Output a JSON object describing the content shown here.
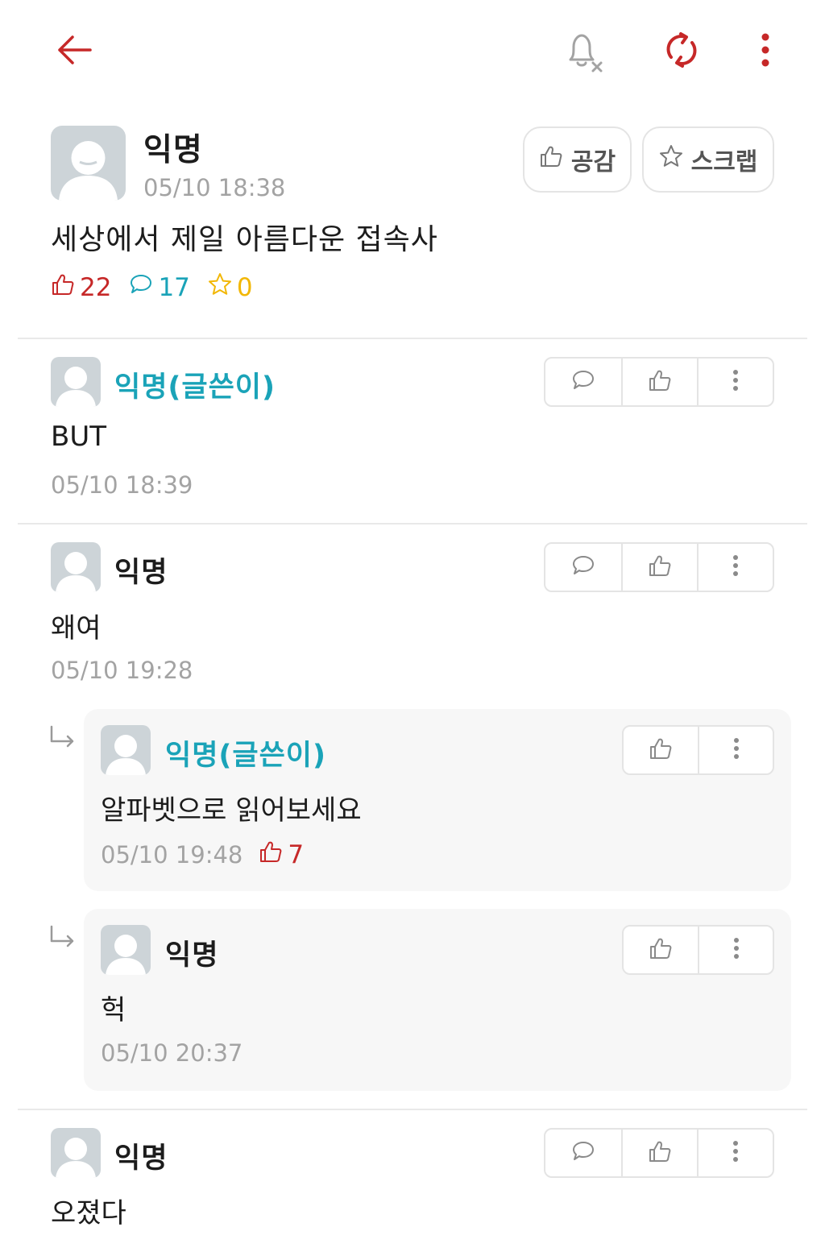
{
  "colors": {
    "accent": "#c62828",
    "op_teal": "#1aa3b8",
    "star_yellow": "#f2b705",
    "meta_gray": "#a3a3a3",
    "border": "#e4e4e4"
  },
  "topbar": {
    "icons": [
      "back-arrow-icon",
      "notification-off-icon",
      "refresh-icon",
      "more-vertical-icon"
    ]
  },
  "post": {
    "author": "익명",
    "time": "05/10 18:38",
    "like_button": "공감",
    "scrap_button": "스크랩",
    "title": "세상에서 제일 아름다운 접속사",
    "like_count": "22",
    "comment_count": "17",
    "scrap_count": "0"
  },
  "comments": [
    {
      "author": "익명(글쓴이)",
      "text": "BUT",
      "time": "05/10 18:39"
    },
    {
      "author": "익명",
      "text": "왜여",
      "time": "05/10 19:28"
    },
    {
      "author": "익명(글쓴이)",
      "text": "알파벳으로 읽어보세요",
      "time": "05/10 19:48",
      "likes": "7"
    },
    {
      "author": "익명",
      "text": "헉",
      "time": "05/10 20:37"
    },
    {
      "author": "익명",
      "text": "오졌다",
      "time": ""
    }
  ]
}
